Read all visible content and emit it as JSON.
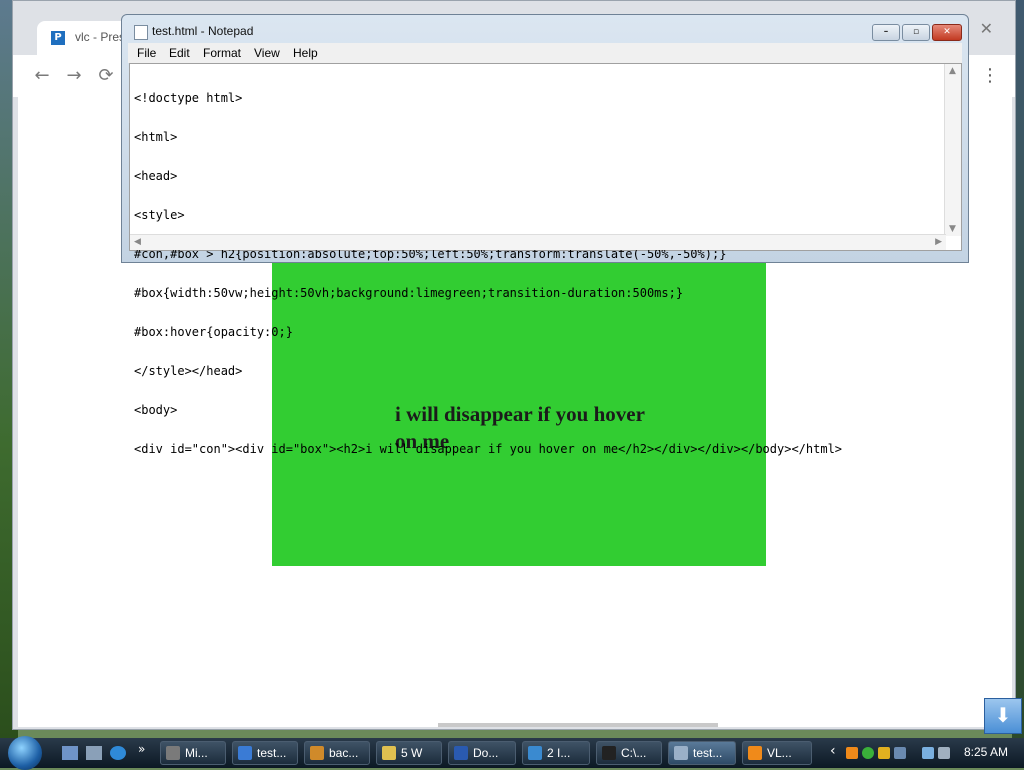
{
  "chrome": {
    "tab_title": "vlc - Pres",
    "favicon_letter": "P",
    "close_glyph": "✕",
    "back_glyph": "←",
    "forward_glyph": "→",
    "reload_glyph": "⟳",
    "menu_glyph": "⋮"
  },
  "page": {
    "heading": "i will disappear if you hover on me",
    "box_color": "#32cd32"
  },
  "notepad": {
    "title": "test.html - Notepad",
    "menu": [
      "File",
      "Edit",
      "Format",
      "View",
      "Help"
    ],
    "controls": {
      "minimize": "–",
      "maximize": "▫",
      "close": "✕"
    },
    "code_lines": [
      "<!doctype html>",
      "<html>",
      "<head>",
      "<style>",
      "#con,#box > h2{position:absolute;top:50%;left:50%;transform:translate(-50%,-50%);}",
      "#box{width:50vw;height:50vh;background:limegreen;transition-duration:500ms;}",
      "#box:hover{opacity:0;}",
      "</style></head>",
      "<body>",
      "<div id=\"con\"><div id=\"box\"><h2>i will disappear if you hover on me</h2></div></div></body></html>"
    ]
  },
  "taskbar": {
    "tasks": [
      {
        "label": "Mi...",
        "color": "#7a7a7a"
      },
      {
        "label": "test...",
        "color": "#3a7bd5"
      },
      {
        "label": "bac...",
        "color": "#d08a2a"
      },
      {
        "label": "5 W",
        "color": "#e0c050"
      },
      {
        "label": "Do...",
        "color": "#2a5ab0"
      },
      {
        "label": "2 I...",
        "color": "#3a8ad0"
      },
      {
        "label": "C:\\...",
        "color": "#222222"
      },
      {
        "label": "test...",
        "color": "#9ab0c8"
      },
      {
        "label": "VL...",
        "color": "#f08a1a"
      }
    ],
    "overflow_glyph": "»",
    "tray_arrow": "‹",
    "time": "8:25 AM"
  },
  "download_glyph": "⬇"
}
